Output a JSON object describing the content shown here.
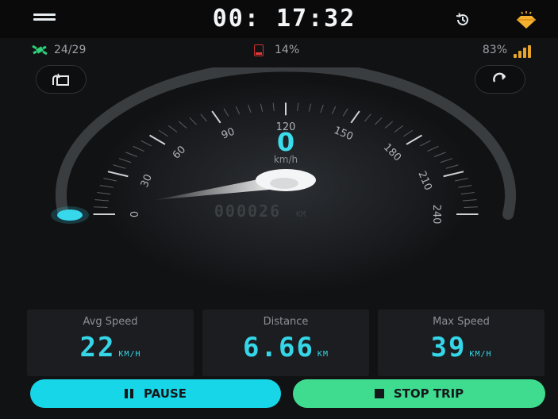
{
  "header": {
    "timer": "00: 17:32"
  },
  "status": {
    "satellites": "24/29",
    "battery": "14%",
    "signal": "83%"
  },
  "speedometer": {
    "speed": "0",
    "speed_unit": "km/h",
    "odometer": "000026",
    "odometer_unit": "KM",
    "scale_labels": [
      "0",
      "30",
      "60",
      "90",
      "120",
      "150",
      "180",
      "210",
      "240"
    ],
    "current_speed_value": 0,
    "max_scale": 240,
    "accent_color": "#3bdcec"
  },
  "stats": {
    "avg_speed_label": "Avg Speed",
    "avg_speed_value": "22",
    "avg_speed_unit": "KM/H",
    "distance_label": "Distance",
    "distance_value": "6.66",
    "distance_unit": "KM",
    "max_speed_label": "Max Speed",
    "max_speed_value": "39",
    "max_speed_unit": "KM/H"
  },
  "actions": {
    "pause_label": "PAUSE",
    "stop_label": "STOP TRIP"
  },
  "icons": [
    "menu-icon",
    "history-icon",
    "premium-icon",
    "satellite-icon",
    "battery-icon",
    "signal-icon",
    "trip-reset-icon",
    "refresh-icon",
    "pause-icon",
    "stop-icon"
  ]
}
